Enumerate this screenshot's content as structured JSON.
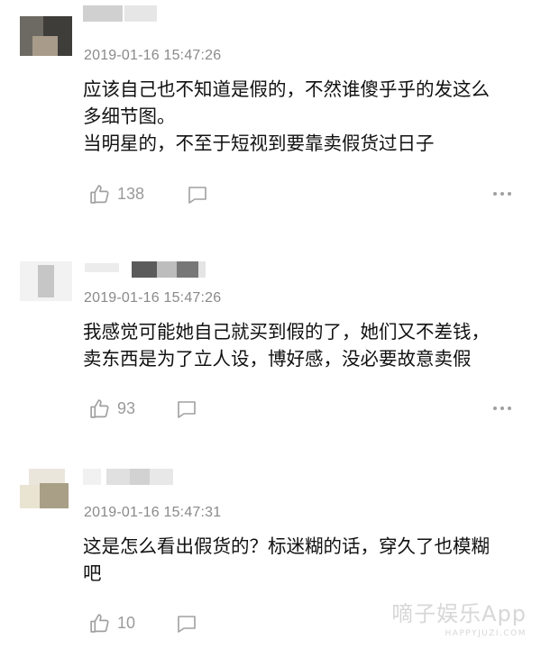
{
  "comments": [
    {
      "time": "2019-01-16 15:47:26",
      "text": "应该自己也不知道是假的，不然谁傻乎乎的发这么\n多细节图。\n当明星的，不至于短视到要靠卖假货过日子",
      "likes": "138",
      "avatar_icon": "blurred-avatar",
      "reply_icon": "comment-bubble-icon",
      "more_icon": "ellipsis-icon"
    },
    {
      "time": "2019-01-16 15:47:26",
      "text": "我感觉可能她自己就买到假的了，她们又不差钱，\n卖东西是为了立人设，博好感，没必要故意卖假",
      "likes": "93",
      "avatar_icon": "blurred-avatar",
      "reply_icon": "comment-bubble-icon",
      "more_icon": "ellipsis-icon"
    },
    {
      "time": "2019-01-16 15:47:31",
      "text": "这是怎么看出假货的？标迷糊的话，穿久了也模糊\n吧",
      "likes": "10",
      "avatar_icon": "blurred-avatar",
      "reply_icon": "comment-bubble-icon",
      "more_icon": "ellipsis-icon"
    }
  ],
  "watermark": {
    "main": "嘀子娱乐App",
    "sub": "HAPPYJUZI.COM"
  },
  "colors": {
    "text": "#111111",
    "meta": "#8a8a8a",
    "icon": "#9a9a9a"
  }
}
